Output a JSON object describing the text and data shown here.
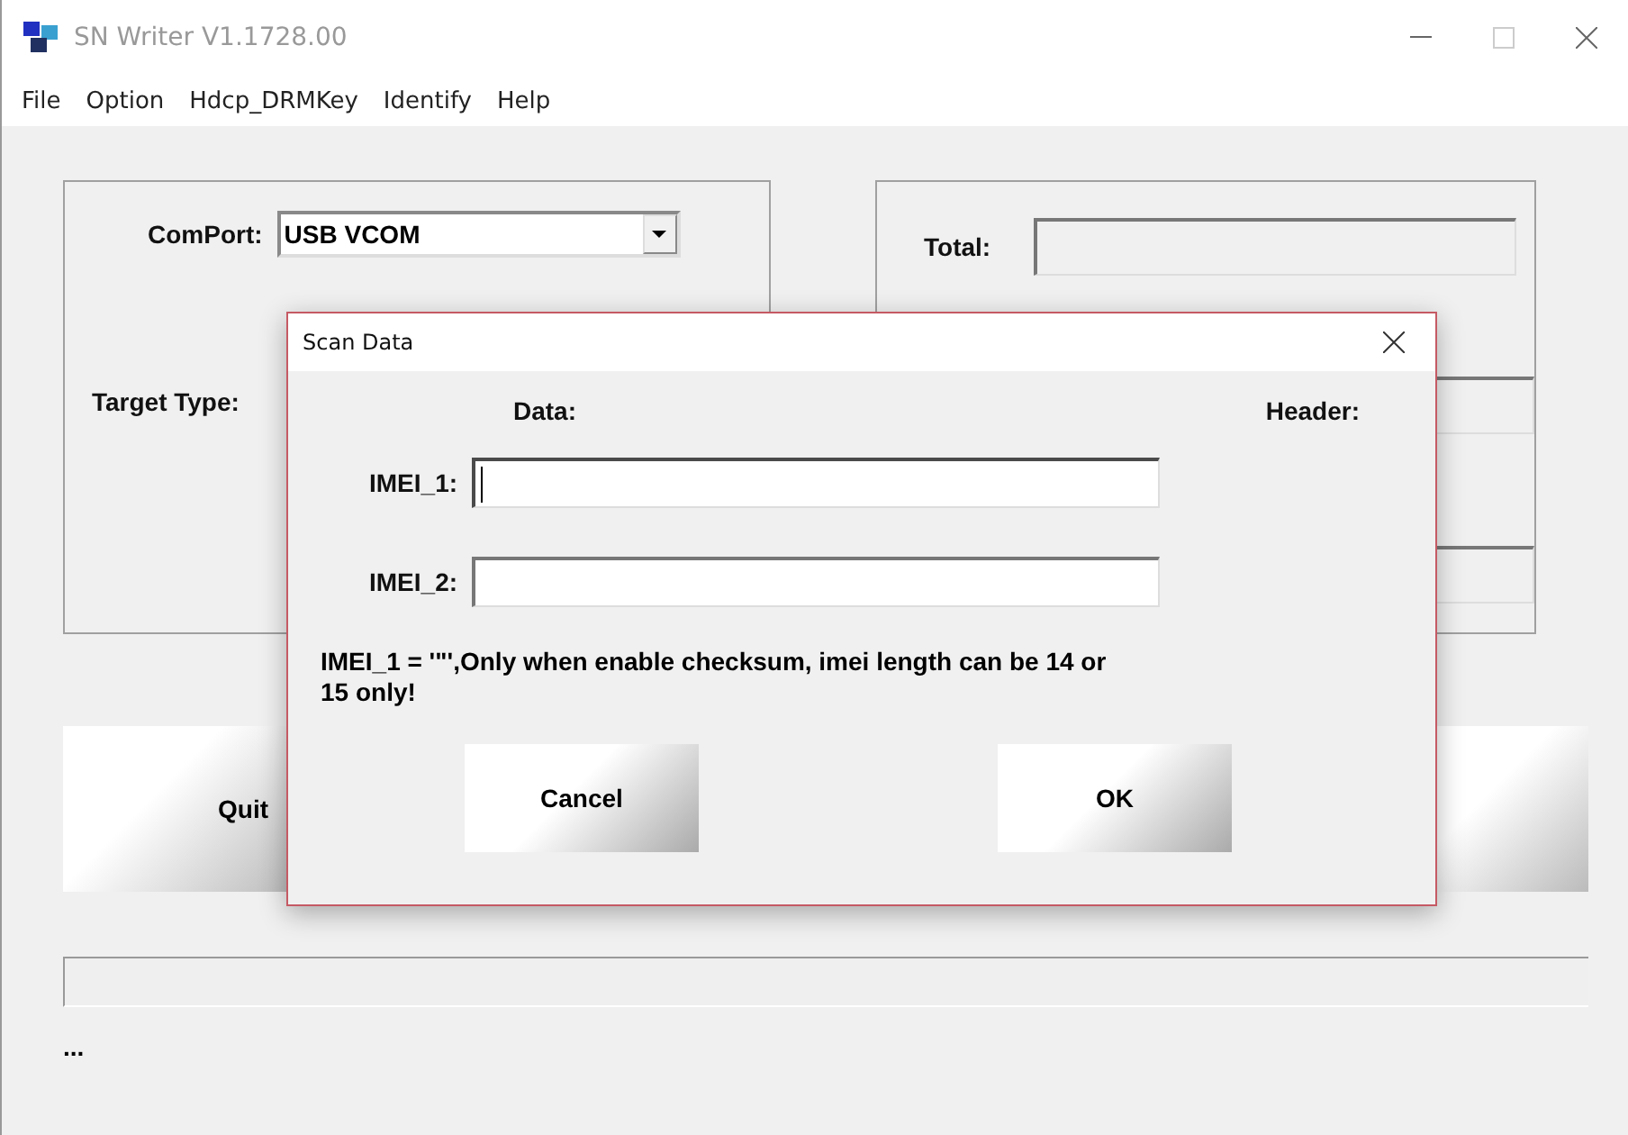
{
  "window": {
    "title": "SN Writer V1.1728.00"
  },
  "menu": [
    "File",
    "Option",
    "Hdcp_DRMKey",
    "Identify",
    "Help"
  ],
  "left_group": {
    "comport_label": "ComPort:",
    "comport_value": "USB VCOM",
    "target_type_label": "Target Type:"
  },
  "right_group": {
    "total_label": "Total:"
  },
  "quit_button": "Quit",
  "progress": {
    "level": 0
  },
  "status": "...",
  "dialog": {
    "title": "Scan Data",
    "data_label": "Data:",
    "header_label": "Header:",
    "fields": [
      {
        "label": "IMEI_1:",
        "focused": true
      },
      {
        "label": "IMEI_2:",
        "focused": false
      }
    ],
    "message": "IMEI_1 = '\"',Only when enable checksum, imei length can be 14 or 15 only!",
    "buttons": [
      "Cancel",
      "OK"
    ]
  }
}
